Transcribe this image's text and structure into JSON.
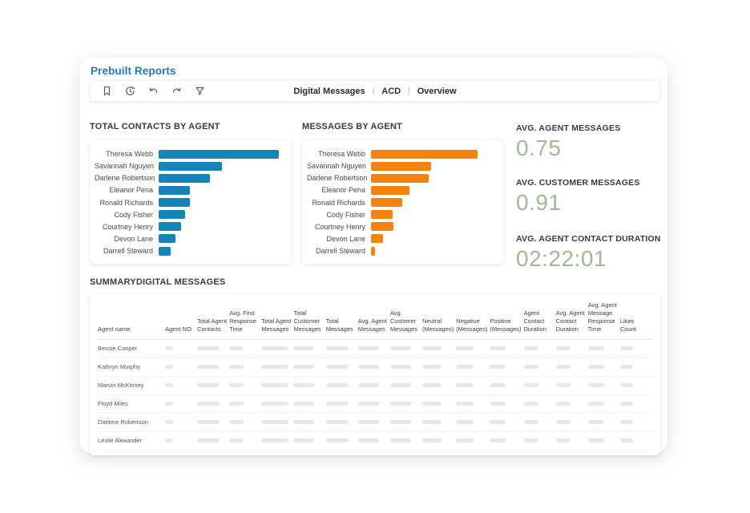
{
  "page": {
    "title": "Prebuilt Reports"
  },
  "toolbar": {
    "icons": [
      "bookmark",
      "history",
      "undo",
      "redo",
      "filter"
    ],
    "tabs": [
      "Digital Messages",
      "ACD",
      "Overview"
    ],
    "separator": "|"
  },
  "metrics": [
    {
      "label": "AVG. AGENT MESSAGES",
      "value": "0.75"
    },
    {
      "label": "AVG. CUSTOMER MESSAGES",
      "value": "0.91"
    },
    {
      "label": "AVG. AGENT CONTACT DURATION",
      "value": "02:22:01"
    }
  ],
  "summary": {
    "title": "SUMMARYDIGITAL MESSAGES",
    "columns": [
      "Agent name",
      "Agent NO",
      "Total Agent Contacts",
      "Avg. First Response Time",
      "Total Agent Messages",
      "Total Customer Messages",
      "Total Messages",
      "Avg. Agent Messages",
      "Avg. Customer Messages",
      "Neutral (Messages)",
      "Negative (Messages)",
      "Positive (Messages)",
      "Agent Contact Duration",
      "Avg. Agent Contact Duration",
      "Avg. Agent Message Response Time",
      "Likes Count"
    ],
    "rows": [
      "Bessie Cooper",
      "Kathryn Murphy",
      "Marvin McKinney",
      "Floyd Miles",
      "Darlene Robertson",
      "Leslie Alexander"
    ]
  },
  "chart_data": [
    {
      "type": "bar",
      "orientation": "horizontal",
      "title": "TOTAL CONTACTS BY AGENT",
      "categories": [
        "Theresa Webb",
        "Savannah Nguyen",
        "Darlene Robertson",
        "Eleanor Pena",
        "Ronald Richards",
        "Cody Fisher",
        "Courtney Henry",
        "Devon Lane",
        "Darrell Steward"
      ],
      "values": [
        100,
        53,
        43,
        26,
        26,
        22,
        19,
        14,
        10
      ],
      "value_note": "relative scale, max bar = 100; no numeric axis shown",
      "color": "#1584b8",
      "max_bar_pct": 98,
      "grid": false,
      "legend": false
    },
    {
      "type": "bar",
      "orientation": "horizontal",
      "title": "MESSAGES BY AGENT",
      "categories": [
        "Theresa Webb",
        "Savannah Nguyen",
        "Darlene Robertson",
        "Eleanor Pena",
        "Ronald Richards",
        "Cody Fisher",
        "Courtney Henry",
        "Devon Lane",
        "Darrell Steward"
      ],
      "values": [
        100,
        56,
        54,
        36,
        29,
        20,
        21,
        11,
        4
      ],
      "value_note": "relative scale, max bar = 100; no numeric axis shown",
      "color": "#f6820b",
      "max_bar_pct": 87,
      "grid": false,
      "legend": false
    }
  ],
  "colors": {
    "brand_blue": "#2577bd",
    "bar_blue": "#1584b8",
    "bar_orange": "#f6820b",
    "metric_green": "#9dbb90"
  }
}
